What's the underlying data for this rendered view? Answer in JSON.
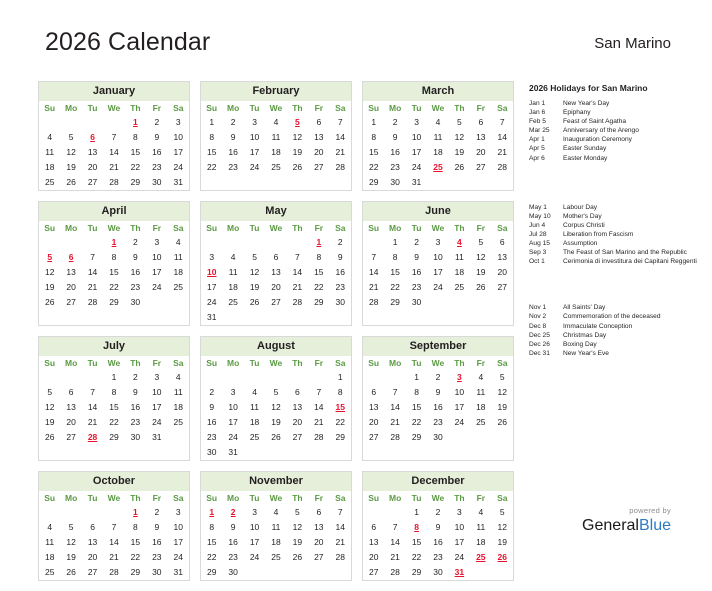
{
  "header": {
    "title": "2026 Calendar",
    "country": "San Marino"
  },
  "weekdays": [
    "Su",
    "Mo",
    "Tu",
    "We",
    "Th",
    "Fr",
    "Sa"
  ],
  "months": [
    {
      "name": "January",
      "weeks": [
        [
          "",
          "",
          "",
          "",
          "1",
          "2",
          "3"
        ],
        [
          "4",
          "5",
          "6",
          "7",
          "8",
          "9",
          "10"
        ],
        [
          "11",
          "12",
          "13",
          "14",
          "15",
          "16",
          "17"
        ],
        [
          "18",
          "19",
          "20",
          "21",
          "22",
          "23",
          "24"
        ],
        [
          "25",
          "26",
          "27",
          "28",
          "29",
          "30",
          "31"
        ]
      ],
      "holidays": [
        "1",
        "6"
      ]
    },
    {
      "name": "February",
      "weeks": [
        [
          "1",
          "2",
          "3",
          "4",
          "5",
          "6",
          "7"
        ],
        [
          "8",
          "9",
          "10",
          "11",
          "12",
          "13",
          "14"
        ],
        [
          "15",
          "16",
          "17",
          "18",
          "19",
          "20",
          "21"
        ],
        [
          "22",
          "23",
          "24",
          "25",
          "26",
          "27",
          "28"
        ]
      ],
      "holidays": [
        "5"
      ]
    },
    {
      "name": "March",
      "weeks": [
        [
          "1",
          "2",
          "3",
          "4",
          "5",
          "6",
          "7"
        ],
        [
          "8",
          "9",
          "10",
          "11",
          "12",
          "13",
          "14"
        ],
        [
          "15",
          "16",
          "17",
          "18",
          "19",
          "20",
          "21"
        ],
        [
          "22",
          "23",
          "24",
          "25",
          "26",
          "27",
          "28"
        ],
        [
          "29",
          "30",
          "31",
          "",
          "",
          "",
          ""
        ]
      ],
      "holidays": [
        "25"
      ]
    },
    {
      "name": "April",
      "weeks": [
        [
          "",
          "",
          "",
          "1",
          "2",
          "3",
          "4"
        ],
        [
          "5",
          "6",
          "7",
          "8",
          "9",
          "10",
          "11"
        ],
        [
          "12",
          "13",
          "14",
          "15",
          "16",
          "17",
          "18"
        ],
        [
          "19",
          "20",
          "21",
          "22",
          "23",
          "24",
          "25"
        ],
        [
          "26",
          "27",
          "28",
          "29",
          "30",
          "",
          ""
        ]
      ],
      "holidays": [
        "1",
        "5",
        "6"
      ]
    },
    {
      "name": "May",
      "weeks": [
        [
          "",
          "",
          "",
          "",
          "",
          "1",
          "2"
        ],
        [
          "3",
          "4",
          "5",
          "6",
          "7",
          "8",
          "9"
        ],
        [
          "10",
          "11",
          "12",
          "13",
          "14",
          "15",
          "16"
        ],
        [
          "17",
          "18",
          "19",
          "20",
          "21",
          "22",
          "23"
        ],
        [
          "24",
          "25",
          "26",
          "27",
          "28",
          "29",
          "30"
        ],
        [
          "31",
          "",
          "",
          "",
          "",
          "",
          ""
        ]
      ],
      "holidays": [
        "1",
        "10"
      ]
    },
    {
      "name": "June",
      "weeks": [
        [
          "",
          "1",
          "2",
          "3",
          "4",
          "5",
          "6"
        ],
        [
          "7",
          "8",
          "9",
          "10",
          "11",
          "12",
          "13"
        ],
        [
          "14",
          "15",
          "16",
          "17",
          "18",
          "19",
          "20"
        ],
        [
          "21",
          "22",
          "23",
          "24",
          "25",
          "26",
          "27"
        ],
        [
          "28",
          "29",
          "30",
          "",
          "",
          "",
          ""
        ]
      ],
      "holidays": [
        "4"
      ]
    },
    {
      "name": "July",
      "weeks": [
        [
          "",
          "",
          "",
          "1",
          "2",
          "3",
          "4"
        ],
        [
          "5",
          "6",
          "7",
          "8",
          "9",
          "10",
          "11"
        ],
        [
          "12",
          "13",
          "14",
          "15",
          "16",
          "17",
          "18"
        ],
        [
          "19",
          "20",
          "21",
          "22",
          "23",
          "24",
          "25"
        ],
        [
          "26",
          "27",
          "28",
          "29",
          "30",
          "31",
          ""
        ]
      ],
      "holidays": [
        "28"
      ]
    },
    {
      "name": "August",
      "weeks": [
        [
          "",
          "",
          "",
          "",
          "",
          "",
          "1"
        ],
        [
          "2",
          "3",
          "4",
          "5",
          "6",
          "7",
          "8"
        ],
        [
          "9",
          "10",
          "11",
          "12",
          "13",
          "14",
          "15"
        ],
        [
          "16",
          "17",
          "18",
          "19",
          "20",
          "21",
          "22"
        ],
        [
          "23",
          "24",
          "25",
          "26",
          "27",
          "28",
          "29"
        ],
        [
          "30",
          "31",
          "",
          "",
          "",
          "",
          ""
        ]
      ],
      "holidays": [
        "15"
      ]
    },
    {
      "name": "September",
      "weeks": [
        [
          "",
          "",
          "1",
          "2",
          "3",
          "4",
          "5"
        ],
        [
          "6",
          "7",
          "8",
          "9",
          "10",
          "11",
          "12"
        ],
        [
          "13",
          "14",
          "15",
          "16",
          "17",
          "18",
          "19"
        ],
        [
          "20",
          "21",
          "22",
          "23",
          "24",
          "25",
          "26"
        ],
        [
          "27",
          "28",
          "29",
          "30",
          "",
          "",
          ""
        ]
      ],
      "holidays": [
        "3"
      ]
    },
    {
      "name": "October",
      "weeks": [
        [
          "",
          "",
          "",
          "",
          "1",
          "2",
          "3"
        ],
        [
          "4",
          "5",
          "6",
          "7",
          "8",
          "9",
          "10"
        ],
        [
          "11",
          "12",
          "13",
          "14",
          "15",
          "16",
          "17"
        ],
        [
          "18",
          "19",
          "20",
          "21",
          "22",
          "23",
          "24"
        ],
        [
          "25",
          "26",
          "27",
          "28",
          "29",
          "30",
          "31"
        ]
      ],
      "holidays": [
        "1"
      ]
    },
    {
      "name": "November",
      "weeks": [
        [
          "1",
          "2",
          "3",
          "4",
          "5",
          "6",
          "7"
        ],
        [
          "8",
          "9",
          "10",
          "11",
          "12",
          "13",
          "14"
        ],
        [
          "15",
          "16",
          "17",
          "18",
          "19",
          "20",
          "21"
        ],
        [
          "22",
          "23",
          "24",
          "25",
          "26",
          "27",
          "28"
        ],
        [
          "29",
          "30",
          "",
          "",
          "",
          "",
          ""
        ]
      ],
      "holidays": [
        "1",
        "2"
      ]
    },
    {
      "name": "December",
      "weeks": [
        [
          "",
          "",
          "1",
          "2",
          "3",
          "4",
          "5"
        ],
        [
          "6",
          "7",
          "8",
          "9",
          "10",
          "11",
          "12"
        ],
        [
          "13",
          "14",
          "15",
          "16",
          "17",
          "18",
          "19"
        ],
        [
          "20",
          "21",
          "22",
          "23",
          "24",
          "25",
          "26"
        ],
        [
          "27",
          "28",
          "29",
          "30",
          "31",
          "",
          ""
        ]
      ],
      "holidays": [
        "8",
        "25",
        "26",
        "31"
      ]
    }
  ],
  "holiday_panel": {
    "heading": "2026 Holidays for San Marino",
    "groups": [
      [
        {
          "date": "Jan 1",
          "name": "New Year's Day"
        },
        {
          "date": "Jan 6",
          "name": "Epiphany"
        },
        {
          "date": "Feb 5",
          "name": "Feast of Saint Agatha"
        },
        {
          "date": "Mar 25",
          "name": "Anniversary of the Arengo"
        },
        {
          "date": "Apr 1",
          "name": "Inauguration Ceremony"
        },
        {
          "date": "Apr 5",
          "name": "Easter Sunday"
        },
        {
          "date": "Apr 6",
          "name": "Easter Monday"
        }
      ],
      [
        {
          "date": "May 1",
          "name": "Labour Day"
        },
        {
          "date": "May 10",
          "name": "Mother's Day"
        },
        {
          "date": "Jun 4",
          "name": "Corpus Christi"
        },
        {
          "date": "Jul 28",
          "name": "Liberation from Fascism"
        },
        {
          "date": "Aug 15",
          "name": "Assumption"
        },
        {
          "date": "Sep 3",
          "name": "The Feast of San Marino and the Republic"
        },
        {
          "date": "Oct 1",
          "name": "Cerimonia di investitura dei Capitani Reggenti"
        }
      ],
      [
        {
          "date": "Nov 1",
          "name": "All Saints' Day"
        },
        {
          "date": "Nov 2",
          "name": "Commemoration of the deceased"
        },
        {
          "date": "Dec 8",
          "name": "Immaculate Conception"
        },
        {
          "date": "Dec 25",
          "name": "Christmas Day"
        },
        {
          "date": "Dec 26",
          "name": "Boxing Day"
        },
        {
          "date": "Dec 31",
          "name": "New Year's Eve"
        }
      ]
    ]
  },
  "footer": {
    "powered_by": "powered by",
    "brand_first": "General",
    "brand_second": "Blue"
  },
  "colors": {
    "month_header_bg": "#e5efda",
    "weekday_text": "#5c9a45",
    "holiday_text": "#e8112d",
    "brand_blue": "#2b7cc4"
  }
}
